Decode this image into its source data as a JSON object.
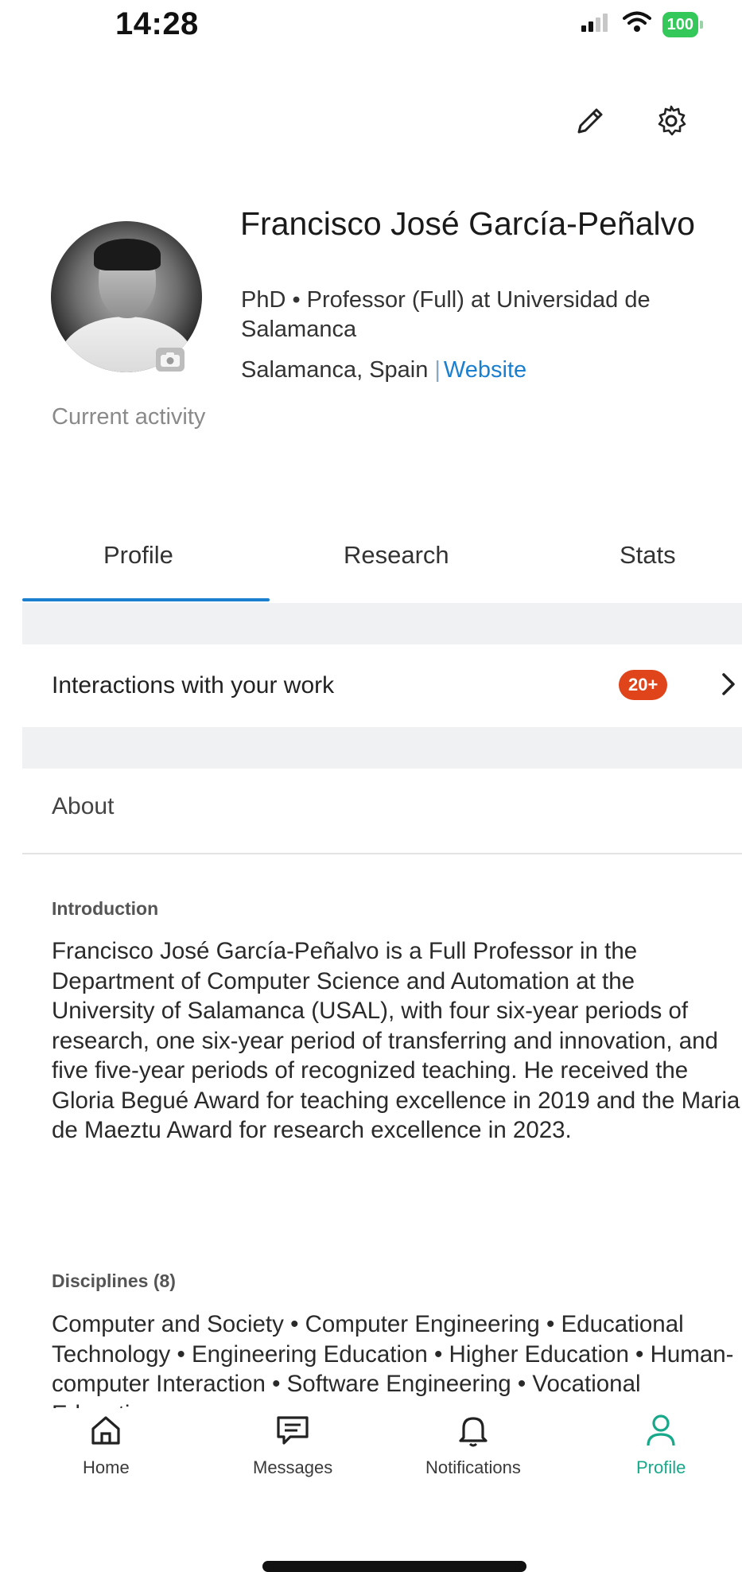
{
  "status_bar": {
    "time": "14:28",
    "battery": "100",
    "icons": [
      "signal-icon",
      "wifi-icon",
      "battery-icon"
    ]
  },
  "top_actions": {
    "icons": [
      "pencil-icon",
      "gear-icon"
    ]
  },
  "profile": {
    "name": "Francisco José García-Peñalvo",
    "headline": "PhD • Professor (Full) at Universidad de Salamanca",
    "location": "Salamanca, Spain",
    "separator": "|",
    "website_label": "Website",
    "current_activity": "Current activity"
  },
  "tabs": [
    {
      "label": "Profile",
      "active": true
    },
    {
      "label": "Research",
      "active": false
    },
    {
      "label": "Stats",
      "active": false
    }
  ],
  "interactions": {
    "label": "Interactions with your work",
    "badge": "20+"
  },
  "about": {
    "title": "About",
    "introduction_label": "Introduction",
    "introduction_text": "Francisco José García-Peñalvo is a Full Professor in the Department of Computer Science and Automation at the University of Salamanca (USAL), with four six-year periods of research, one six-year period of transferring and innovation, and five five-year periods of recognized teaching. He received the Gloria Begué Award for teaching excellence in 2019 and the Maria de Maeztu Award for research excellence in 2023.",
    "disciplines_label": "Disciplines (8)",
    "disciplines_text": "Computer and Society • Computer Engineering • Educational Technology • Engineering Education • Higher Education • Human-computer Interaction • Software Engineering • Vocational Education"
  },
  "bottom_nav": [
    {
      "label": "Home",
      "icon": "home-icon",
      "active": false
    },
    {
      "label": "Messages",
      "icon": "messages-icon",
      "active": false
    },
    {
      "label": "Notifications",
      "icon": "bell-icon",
      "active": false
    },
    {
      "label": "Profile",
      "icon": "person-icon",
      "active": true
    }
  ],
  "colors": {
    "accent": "#1b7fd0",
    "badge": "#e0441b",
    "nav_active": "#18a88a",
    "battery": "#34c759"
  }
}
